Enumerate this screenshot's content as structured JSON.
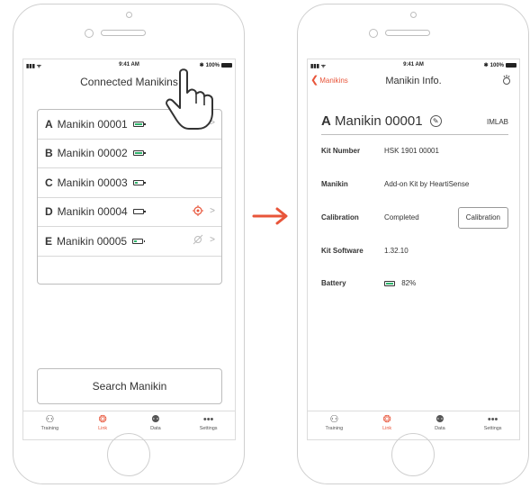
{
  "status_bar": {
    "time": "9:41 AM",
    "battery_pct": "100%"
  },
  "left_screen": {
    "title": "Connected Manikins",
    "manikins": [
      {
        "letter": "A",
        "name": "Manikin 00001",
        "battery": 0.8,
        "status_icon": "none"
      },
      {
        "letter": "B",
        "name": "Manikin 00002",
        "battery": 0.8,
        "status_icon": "none"
      },
      {
        "letter": "C",
        "name": "Manikin 00003",
        "battery": 0.3,
        "status_icon": "none"
      },
      {
        "letter": "D",
        "name": "Manikin 00004",
        "battery": 0.0,
        "status_icon": "target-icon"
      },
      {
        "letter": "E",
        "name": "Manikin 00005",
        "battery": 0.3,
        "status_icon": "disconnected-icon"
      }
    ],
    "search_button": "Search Manikin"
  },
  "right_screen": {
    "back_label": "Manikins",
    "nav_title": "Manikin Info.",
    "manikin_letter": "A",
    "manikin_name": "Manikin 00001",
    "owner": "IMLAB",
    "fields": {
      "kit_number_label": "Kit Number",
      "kit_number_value": "HSK 1901 00001",
      "manikin_label": "Manikin",
      "manikin_value": "Add-on Kit by HeartiSense",
      "calibration_label": "Calibration",
      "calibration_value": "Completed",
      "calibration_button": "Calibration",
      "kit_software_label": "Kit Software",
      "kit_software_value": "1.32.10",
      "battery_label": "Battery",
      "battery_value": "82%",
      "battery_level": 0.82
    }
  },
  "tabs": [
    {
      "label": "Training",
      "icon": "training-icon",
      "active": false
    },
    {
      "label": "Link",
      "icon": "link-icon",
      "active": true
    },
    {
      "label": "Data",
      "icon": "data-icon",
      "active": false
    },
    {
      "label": "Settings",
      "icon": "settings-icon",
      "active": false
    }
  ],
  "colors": {
    "accent": "#e8553a",
    "battery_green": "#2fb36c",
    "border": "#bdbdbd"
  }
}
